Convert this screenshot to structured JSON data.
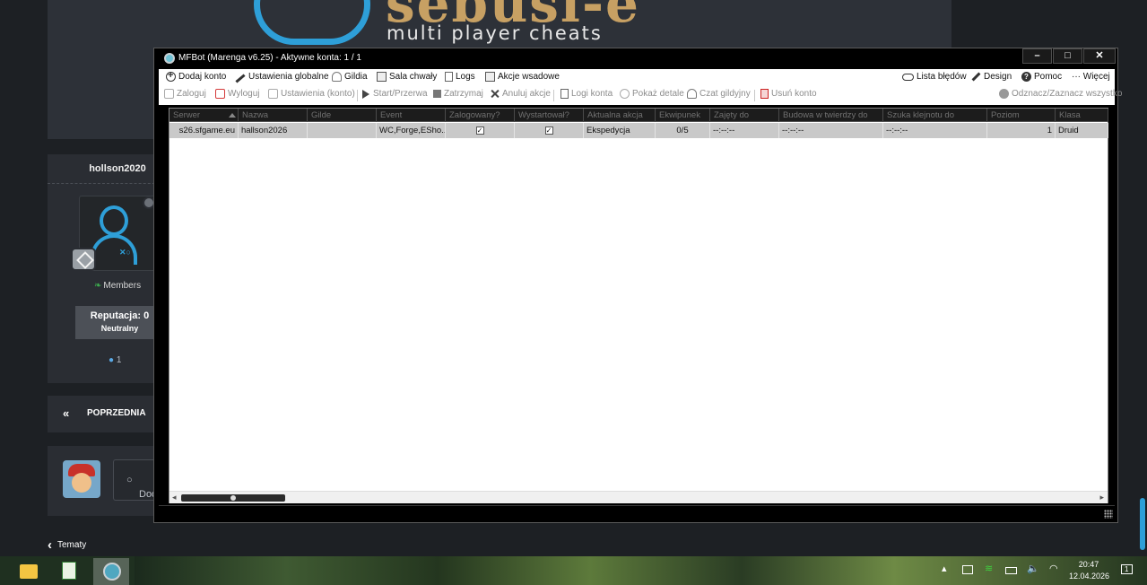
{
  "website": {
    "banner_brand": "sebusi-e",
    "banner_subtitle": "multi player cheats",
    "profile": {
      "username": "hollson2020",
      "group": "Members",
      "reputation_label": "Reputacja: 0",
      "reputation_level": "Neutralny",
      "post_count": "1"
    },
    "pagination_prev": "POPRZEDNIA",
    "reply_placeholder": "Doo",
    "back_link": "Tematy"
  },
  "window": {
    "title": "MFBot (Marenga v6.25) - Aktywne konta: 1 / 1",
    "min": "–",
    "max": "□",
    "close": "✕"
  },
  "toolbar1": {
    "add_account": "Dodaj konto",
    "global_settings": "Ustawienia globalne",
    "guild": "Gildia",
    "hall_of_fame": "Sala chwały",
    "logs": "Logs",
    "batch_actions": "Akcje wsadowe",
    "error_list": "Lista błędów",
    "design": "Design",
    "help": "Pomoc",
    "more": "··· Więcej"
  },
  "toolbar2": {
    "login": "Zaloguj",
    "logout": "Wyloguj",
    "account_settings": "Ustawienia (konto)",
    "start_pause": "Start/Przerwa",
    "stop": "Zatrzymaj",
    "cancel_actions": "Anuluj akcje",
    "account_logs": "Logi konta",
    "show_details": "Pokaż detale",
    "guild_chat": "Czat gildyjny",
    "delete_account": "Usuń konto",
    "toggle_all": "Odznacz/Zaznacz wszystko"
  },
  "grid": {
    "columns": [
      "Serwer",
      "Nazwa",
      "Gilde",
      "Event",
      "Zalogowany?",
      "Wystartował?",
      "Aktualna akcja",
      "Ekwipunek",
      "Zajęty do",
      "Budowa w twierdzy do",
      "Szuka klejnotu do",
      "Poziom",
      "Klasa"
    ],
    "rows": [
      {
        "server": "s26.sfgame.eu",
        "name": "hallson2026",
        "guild": "",
        "event": "WC,Forge,ESho...",
        "logged_in": "✓",
        "started": "✓",
        "current_action": "Ekspedycja",
        "inventory": "0/5",
        "busy_until": "--:--:--",
        "fortress_until": "--:--:--",
        "gem_until": "--:--:--",
        "level": "1",
        "class": "Druid"
      }
    ]
  },
  "taskbar": {
    "clock_time": "20:47",
    "clock_date": "12.04.2026",
    "tray_chevron": "▴",
    "tray_volume": "🔈",
    "notifications": "1"
  },
  "colors": {
    "accent_blue": "#2e9fd8",
    "logo_gold": "#c7a063",
    "row_selected": "#c9c9c9"
  }
}
